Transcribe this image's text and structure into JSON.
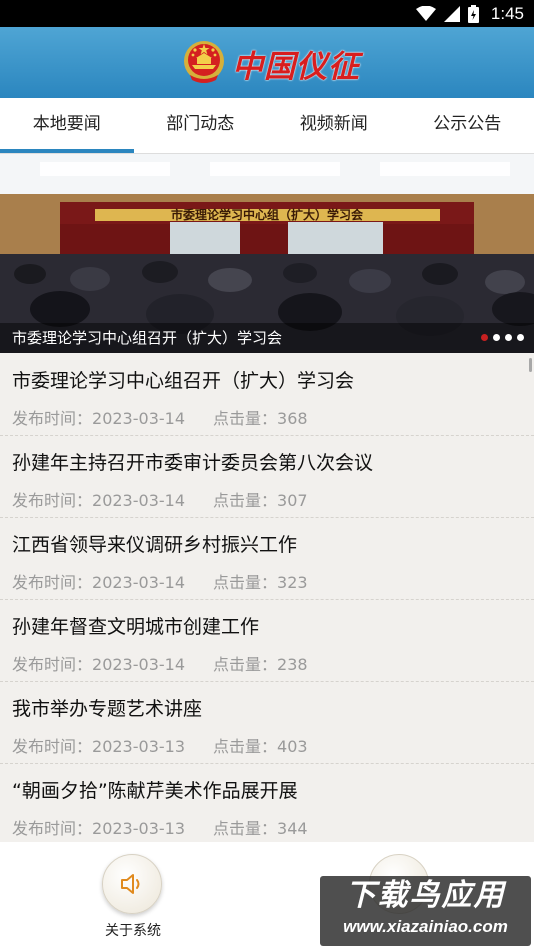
{
  "status_bar": {
    "time": "1:45",
    "icons": [
      "wifi-icon",
      "signal-icon",
      "battery-icon"
    ]
  },
  "header": {
    "brand": "中国仪征",
    "emblem_icon": "national-emblem-icon"
  },
  "tabs": [
    {
      "label": "本地要闻",
      "active": true
    },
    {
      "label": "部门动态",
      "active": false
    },
    {
      "label": "视频新闻",
      "active": false
    },
    {
      "label": "公示公告",
      "active": false
    }
  ],
  "banner": {
    "caption": "市委理论学习中心组召开（扩大）学习会",
    "slide_banner_text": "市委理论学习中心组（扩大）学习会",
    "dots": 4,
    "active_dot": 1
  },
  "news": [
    {
      "title": "市委理论学习中心组召开（扩大）学习会",
      "date_label": "发布时间：",
      "date": "2023-03-14",
      "clicks_label": "点击量：",
      "clicks": "368"
    },
    {
      "title": "孙建年主持召开市委审计委员会第八次会议",
      "date_label": "发布时间：",
      "date": "2023-03-14",
      "clicks_label": "点击量：",
      "clicks": "307"
    },
    {
      "title": "江西省领导来仪调研乡村振兴工作",
      "date_label": "发布时间：",
      "date": "2023-03-14",
      "clicks_label": "点击量：",
      "clicks": "323"
    },
    {
      "title": "孙建年督查文明城市创建工作",
      "date_label": "发布时间：",
      "date": "2023-03-14",
      "clicks_label": "点击量：",
      "clicks": "238"
    },
    {
      "title": "我市举办专题艺术讲座",
      "date_label": "发布时间：",
      "date": "2023-03-13",
      "clicks_label": "点击量：",
      "clicks": "403"
    },
    {
      "title": "“朝画夕拾”陈献芹美术作品展开展",
      "date_label": "发布时间：",
      "date": "2023-03-13",
      "clicks_label": "点击量：",
      "clicks": "344"
    }
  ],
  "bottom": {
    "about_label": "关于系统",
    "about_icon": "speaker-icon"
  },
  "watermark": {
    "text": "下载鸟应用",
    "url": "www.xiazainiao.com"
  },
  "colors": {
    "header_blue": "#2b86bf",
    "brand_red": "#d81e1e",
    "tab_indicator": "#2b86bf"
  }
}
